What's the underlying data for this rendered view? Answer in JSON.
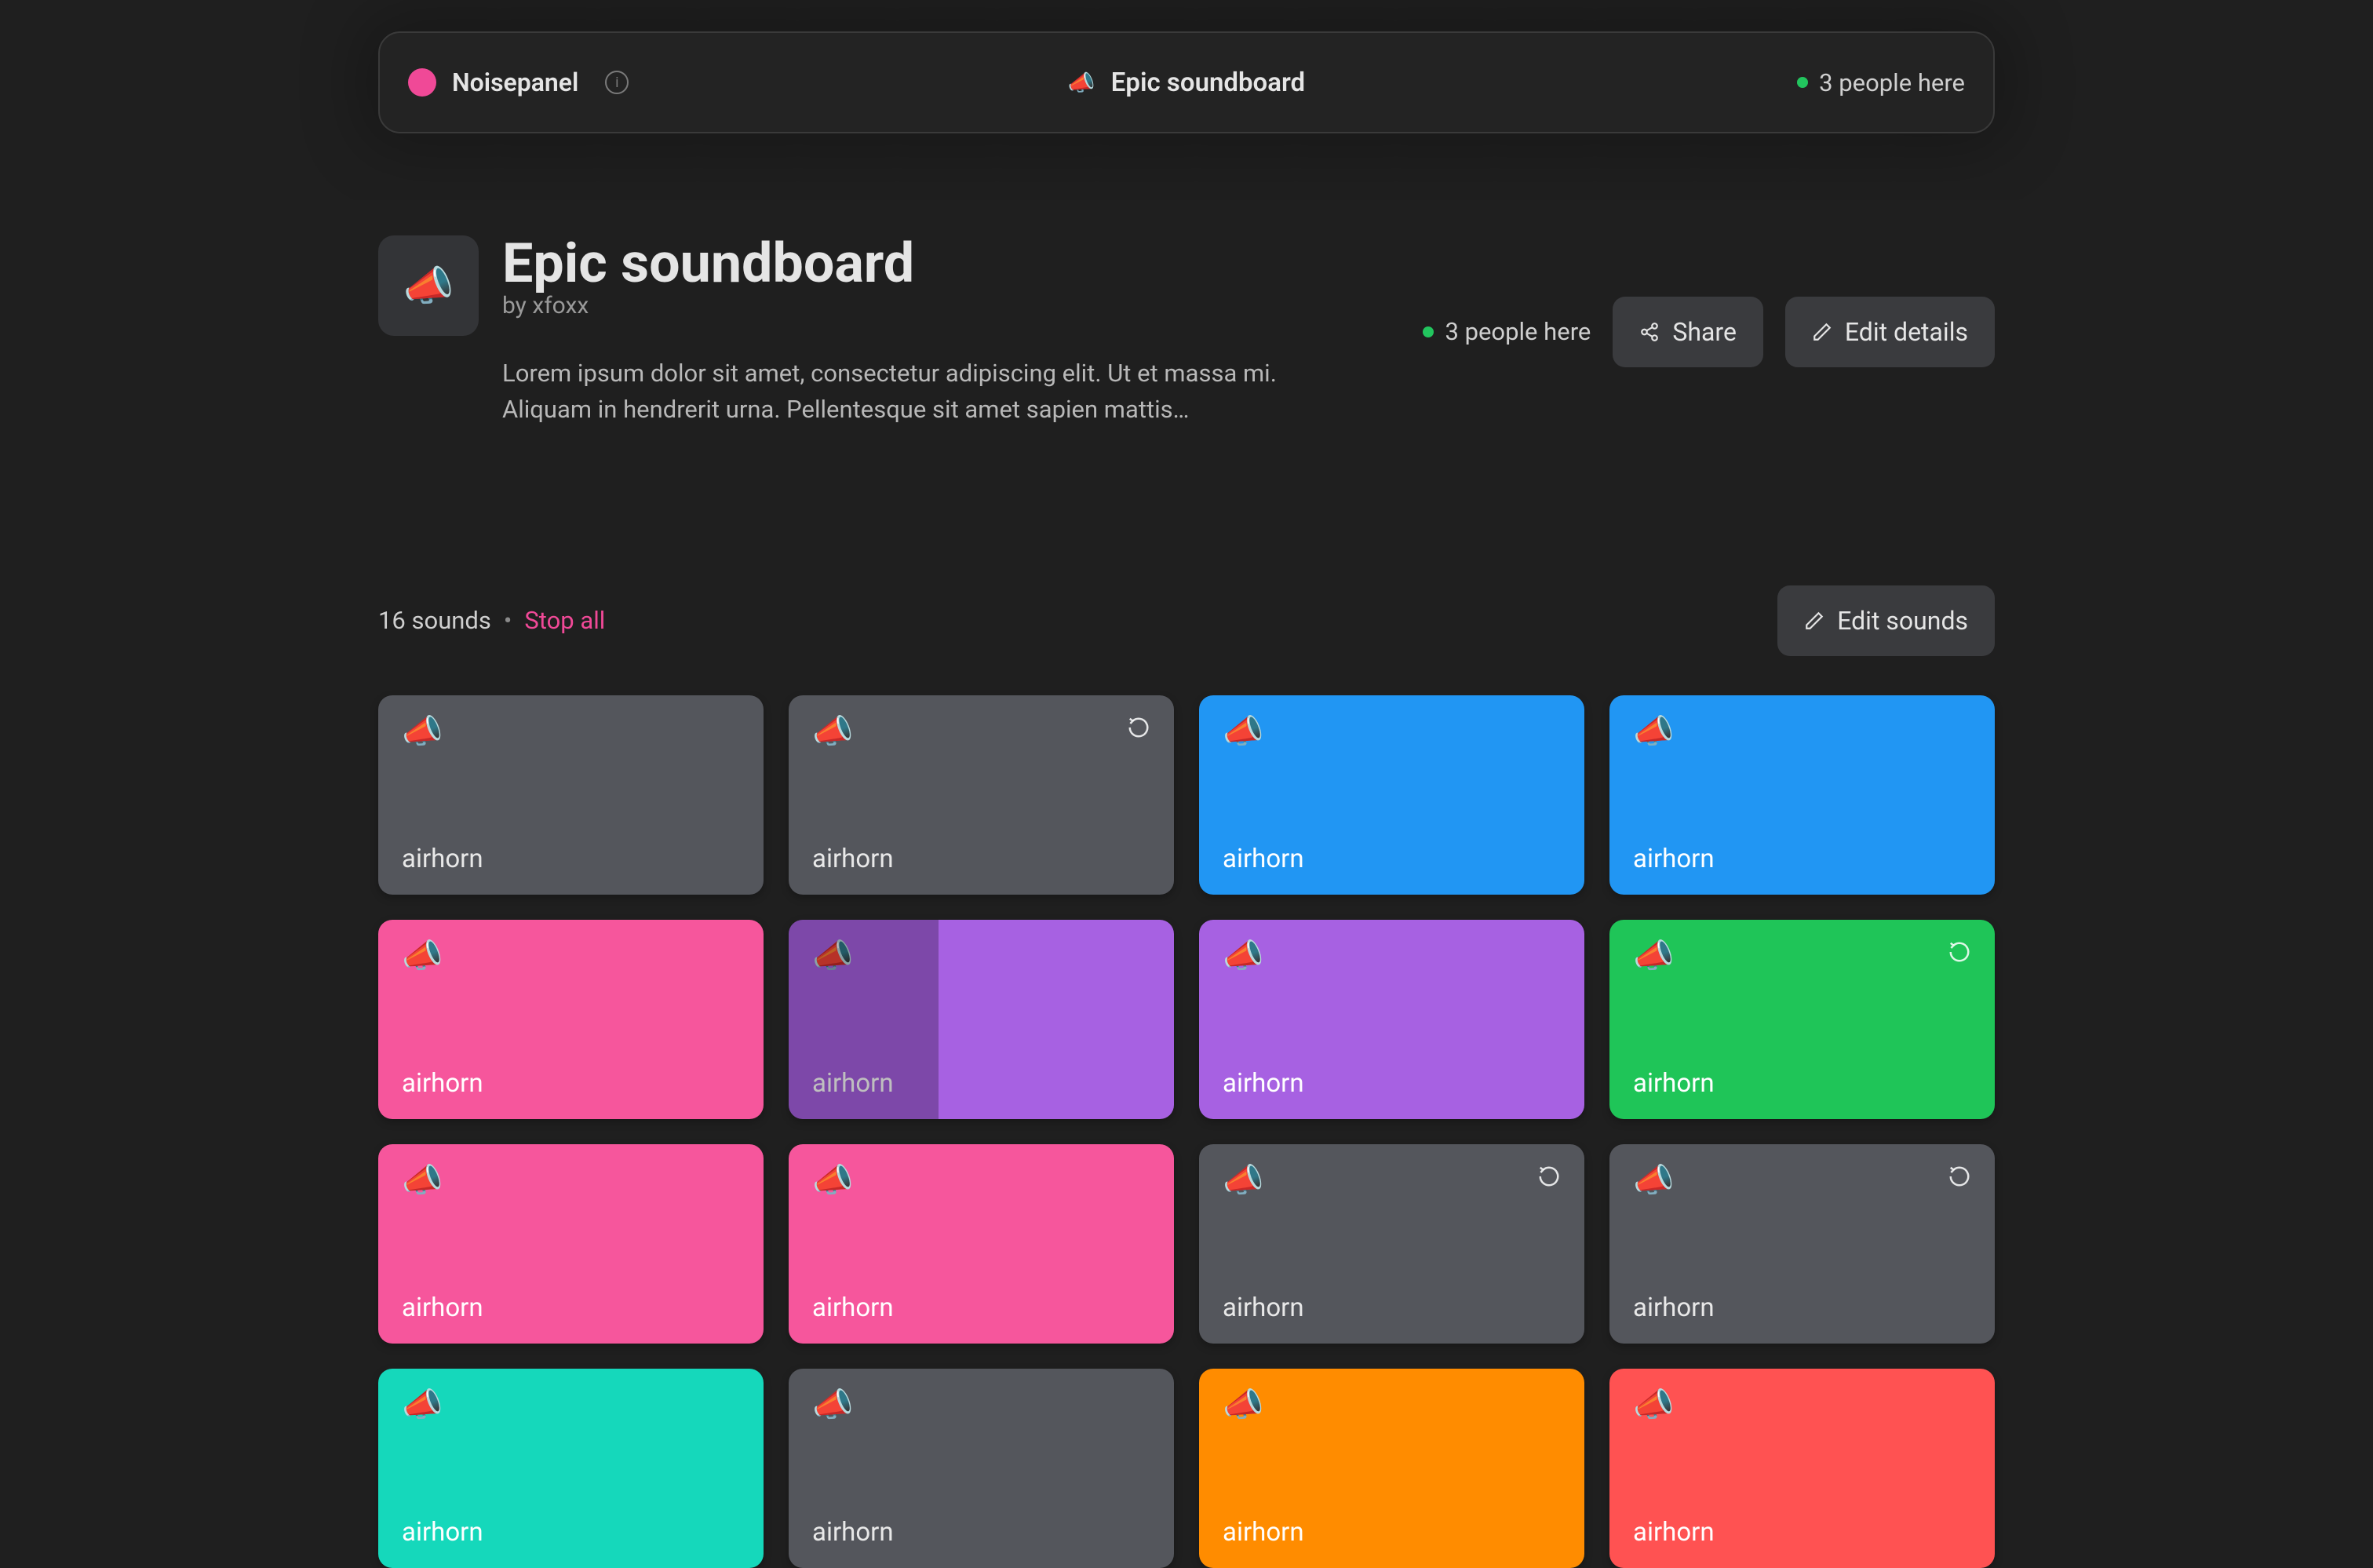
{
  "brand": {
    "name": "Noisepanel"
  },
  "topbar": {
    "emoji": "📣",
    "title": "Epic soundboard",
    "presence": "3 people here"
  },
  "board": {
    "emoji": "📣",
    "title": "Epic soundboard",
    "by_prefix": "by ",
    "author": "xfoxx",
    "presence": "3 people here",
    "share_label": "Share",
    "edit_details_label": "Edit details",
    "description": "Lorem ipsum dolor sit amet, consectetur adipiscing elit. Ut et massa mi. Aliquam in hendrerit urna. Pellentesque sit amet sapien mattis…"
  },
  "toolbar": {
    "count_label": "16 sounds",
    "stop_all_label": "Stop all",
    "edit_sounds_label": "Edit sounds"
  },
  "colors": {
    "gray": "#54565c",
    "blue": "#2196f3",
    "pink": "#f6569c",
    "purple": "#a761e2",
    "green": "#1fc558",
    "teal": "#15d8bb",
    "orange": "#ff8c00",
    "red": "#ff5252"
  },
  "sounds": [
    {
      "name": "airhorn",
      "color": "gray",
      "loop": false,
      "progress": 0
    },
    {
      "name": "airhorn",
      "color": "gray",
      "loop": true,
      "progress": 0
    },
    {
      "name": "airhorn",
      "color": "blue",
      "loop": false,
      "progress": 0
    },
    {
      "name": "airhorn",
      "color": "blue",
      "loop": false,
      "progress": 0
    },
    {
      "name": "airhorn",
      "color": "pink",
      "loop": false,
      "progress": 0
    },
    {
      "name": "airhorn",
      "color": "purple",
      "loop": false,
      "progress": 0.39
    },
    {
      "name": "airhorn",
      "color": "purple",
      "loop": false,
      "progress": 0
    },
    {
      "name": "airhorn",
      "color": "green",
      "loop": true,
      "progress": 0
    },
    {
      "name": "airhorn",
      "color": "pink",
      "loop": false,
      "progress": 0
    },
    {
      "name": "airhorn",
      "color": "pink",
      "loop": false,
      "progress": 0
    },
    {
      "name": "airhorn",
      "color": "gray",
      "loop": true,
      "progress": 0
    },
    {
      "name": "airhorn",
      "color": "gray",
      "loop": true,
      "progress": 0
    },
    {
      "name": "airhorn",
      "color": "teal",
      "loop": false,
      "progress": 0
    },
    {
      "name": "airhorn",
      "color": "gray",
      "loop": false,
      "progress": 0
    },
    {
      "name": "airhorn",
      "color": "orange",
      "loop": false,
      "progress": 0
    },
    {
      "name": "airhorn",
      "color": "red",
      "loop": false,
      "progress": 0
    }
  ]
}
